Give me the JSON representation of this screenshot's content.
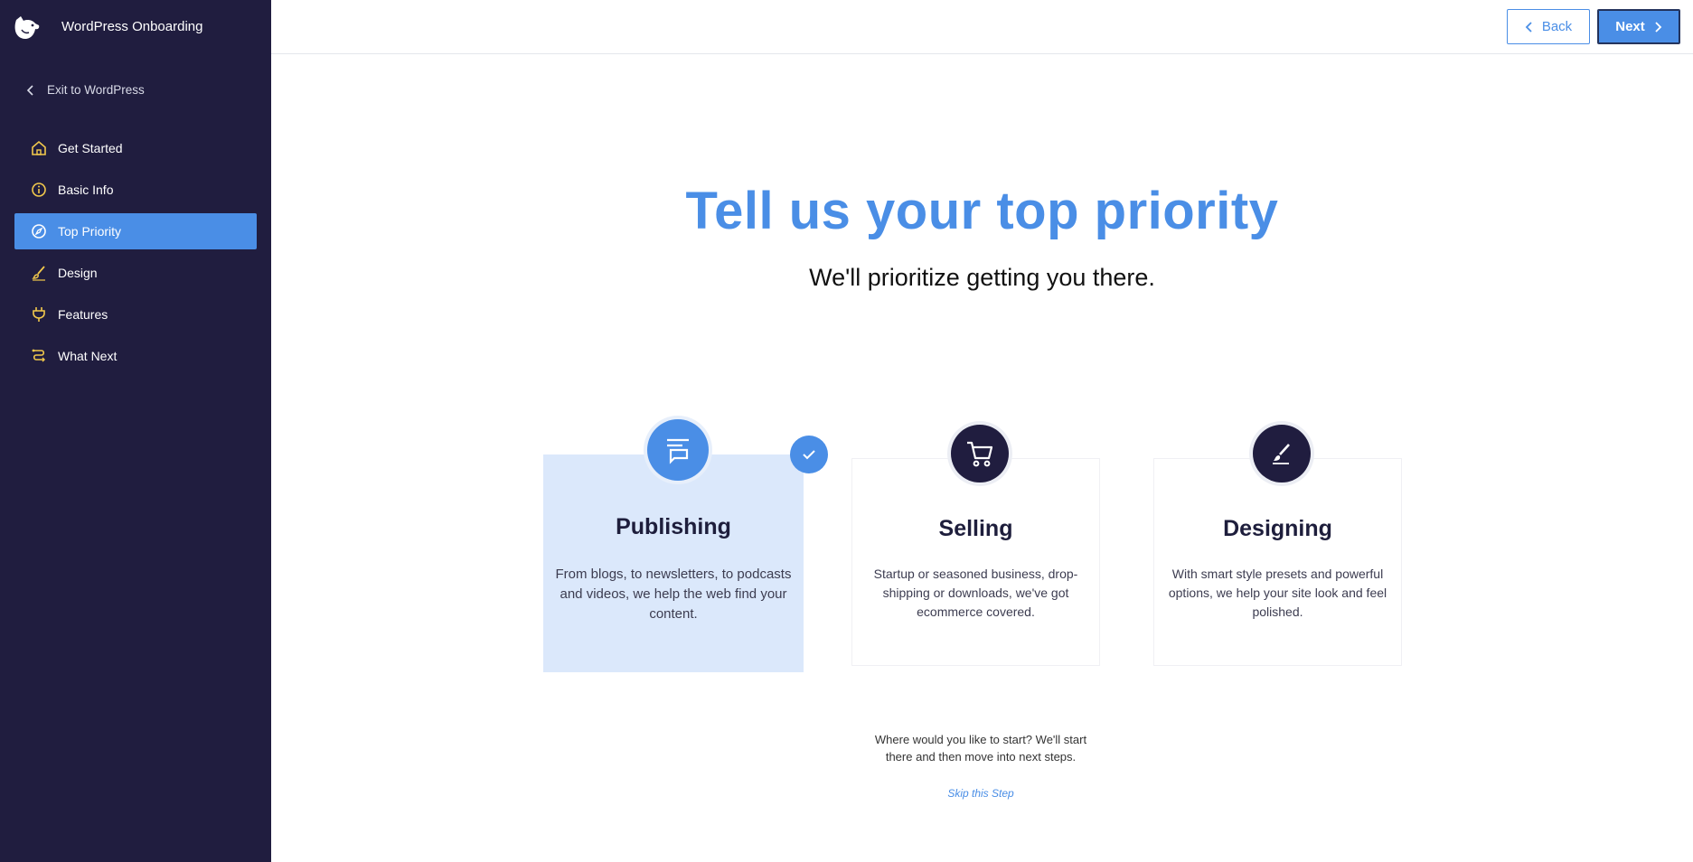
{
  "app": {
    "title": "WordPress Onboarding"
  },
  "sidebar": {
    "exit_label": "Exit to WordPress",
    "items": [
      {
        "label": "Get Started",
        "icon": "home-icon",
        "active": false
      },
      {
        "label": "Basic Info",
        "icon": "info-icon",
        "active": false
      },
      {
        "label": "Top Priority",
        "icon": "compass-icon",
        "active": true
      },
      {
        "label": "Design",
        "icon": "brush-icon",
        "active": false
      },
      {
        "label": "Features",
        "icon": "plug-icon",
        "active": false
      },
      {
        "label": "What Next",
        "icon": "route-icon",
        "active": false
      }
    ]
  },
  "toolbar": {
    "back_label": "Back",
    "next_label": "Next"
  },
  "main": {
    "title": "Tell us your top priority",
    "subtitle": "We'll prioritize getting you there.",
    "cards": [
      {
        "title": "Publishing",
        "icon": "publishing-icon",
        "selected": true,
        "description": "From blogs, to newsletters, to podcasts and videos, we help the web find your content."
      },
      {
        "title": "Selling",
        "icon": "cart-icon",
        "selected": false,
        "description": "Startup or seasoned business, drop-shipping or downloads, we've got ecommerce covered."
      },
      {
        "title": "Designing",
        "icon": "brush-icon",
        "selected": false,
        "description": "With smart style presets and powerful options, we help your site look and feel polished."
      }
    ],
    "hint": "Where would you like to start? We'll start there and then move into next steps.",
    "skip_label": "Skip this Step"
  },
  "colors": {
    "accent": "#4a8ee6",
    "sidebar_bg": "#201d3f",
    "icon_yellow": "#f2c94c",
    "selected_card_bg": "#dbe8fb"
  }
}
